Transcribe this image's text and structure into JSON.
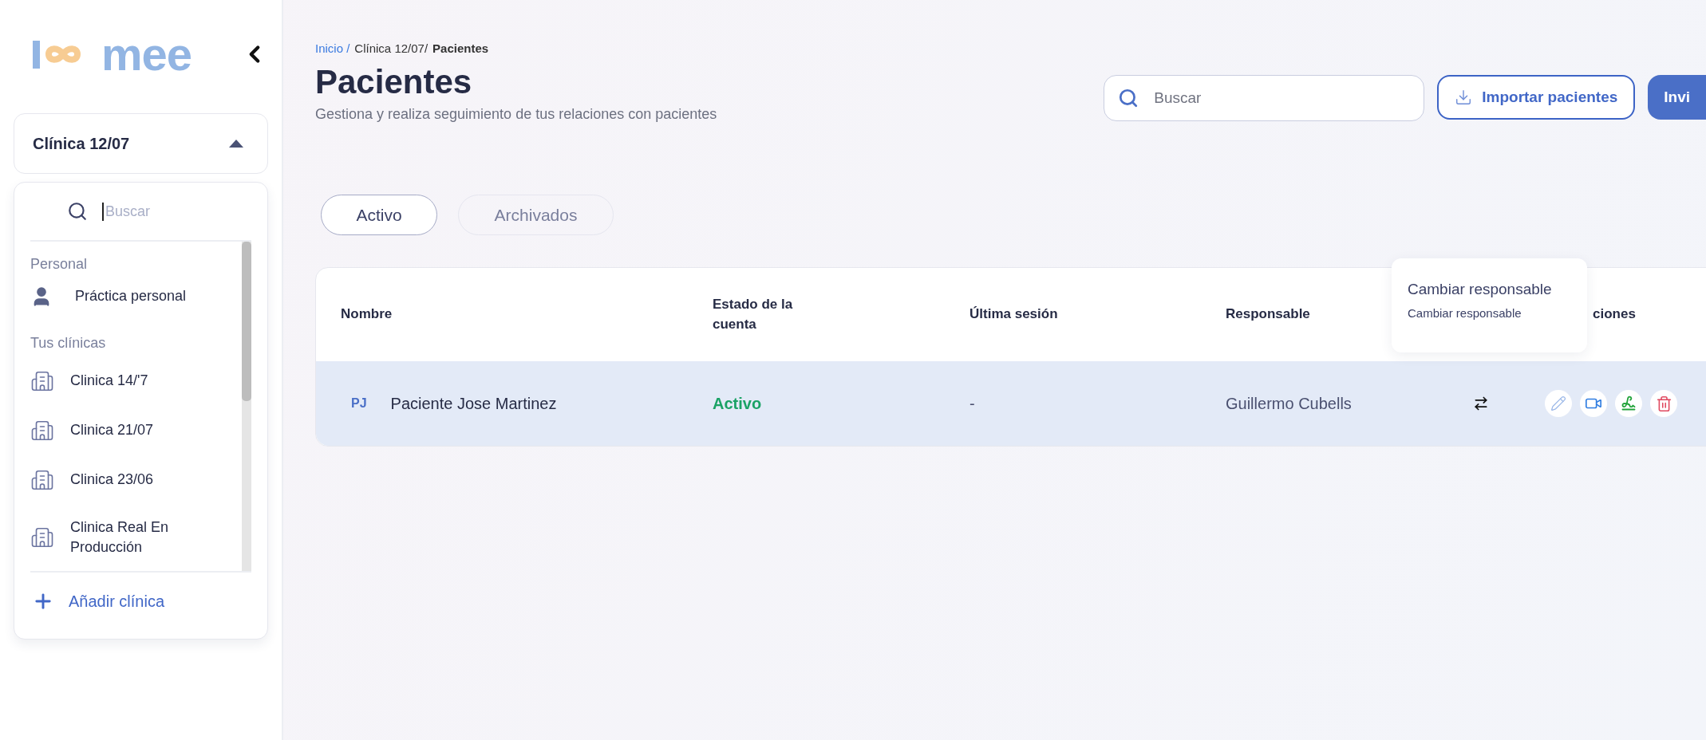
{
  "brand": {
    "name": "mee"
  },
  "sidebar": {
    "clinic_select": {
      "value": "Clínica 12/07",
      "expanded": true
    },
    "dropdown": {
      "search_placeholder": "Buscar",
      "sections": [
        {
          "title": "Personal",
          "items": [
            {
              "label": "Práctica personal",
              "kind": "person"
            }
          ]
        },
        {
          "title": "Tus clínicas",
          "items": [
            {
              "label": "Clinica 14/'7",
              "kind": "building"
            },
            {
              "label": "Clinica 21/07",
              "kind": "building"
            },
            {
              "label": "Clinica 23/06",
              "kind": "building"
            },
            {
              "label": "Clinica Real En Producción",
              "kind": "building"
            }
          ]
        }
      ],
      "add_label": "Añadir clínica"
    }
  },
  "breadcrumb": [
    {
      "label": "Inicio /",
      "kind": "link"
    },
    {
      "label": "Clínica 12/07/",
      "kind": "plain"
    },
    {
      "label": "Pacientes",
      "kind": "current"
    }
  ],
  "page": {
    "title": "Pacientes",
    "subtitle": "Gestiona y realiza seguimiento de tus relaciones con pacientes"
  },
  "search": {
    "placeholder": "Buscar"
  },
  "buttons": [
    {
      "label": "Importar pacientes",
      "kind": "outline"
    },
    {
      "label": "Invi",
      "kind": "primary"
    }
  ],
  "tabs": [
    {
      "label": "Activo",
      "selected": true
    },
    {
      "label": "Archivados",
      "selected": false
    }
  ],
  "table": {
    "columns": [
      "Nombre",
      "Estado de la cuenta",
      "Última sesión",
      "Responsable",
      "",
      "ciones"
    ],
    "rows": [
      {
        "initials": "PJ",
        "name": "Paciente Jose Martinez",
        "status": {
          "text": "Activo",
          "kind": "active"
        },
        "last_session": "-",
        "owner": "Guillermo Cubells",
        "selected": true
      }
    ]
  },
  "tooltip": {
    "title": "Cambiar responsable",
    "text": "Cambiar responsable"
  }
}
